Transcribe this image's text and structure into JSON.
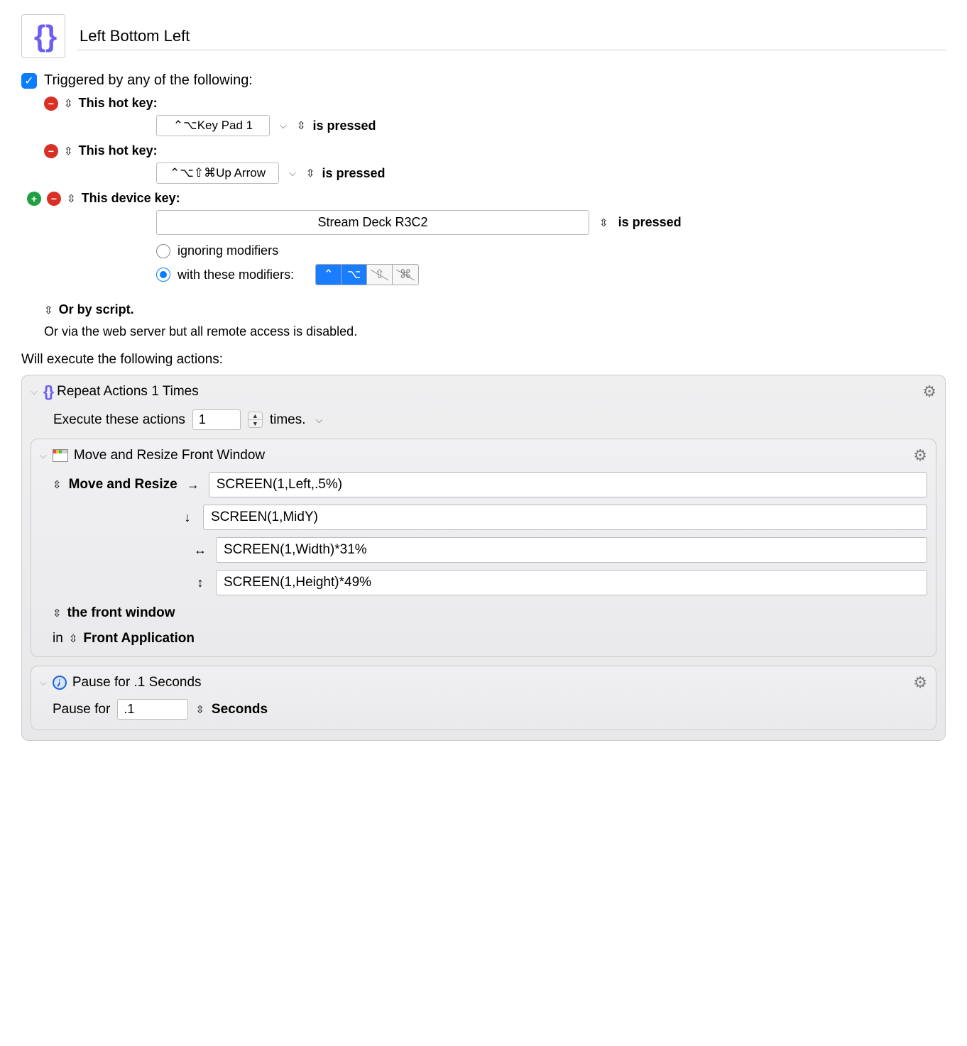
{
  "macro_title": "Left Bottom Left",
  "triggered_label": "Triggered by any of the following:",
  "hotkey_label": "This hot key:",
  "device_key_label": "This device key:",
  "is_pressed": "is pressed",
  "hotkey1": "⌃⌥Key Pad 1",
  "hotkey2": "⌃⌥⇧⌘Up Arrow",
  "device_key": "Stream Deck R3C2",
  "ignoring_mods": "ignoring modifiers",
  "with_mods": "with these modifiers:",
  "mods": {
    "ctrl": "⌃",
    "opt": "⌥",
    "shift": "⇧",
    "cmd": "⌘"
  },
  "or_script": "Or by script.",
  "remote_text": "Or via the web server but all remote access is disabled.",
  "will_execute": "Will execute the following actions:",
  "repeat_title": "Repeat Actions 1 Times",
  "execute_these": "Execute these actions",
  "times_label": "times.",
  "repeat_count": "1",
  "move_resize_title": "Move and Resize Front Window",
  "move_resize_label": "Move and Resize",
  "pos_right": "SCREEN(1,Left,.5%)",
  "pos_down": "SCREEN(1,MidY)",
  "pos_width": "SCREEN(1,Width)*31%",
  "pos_height": "SCREEN(1,Height)*49%",
  "front_window": "the front window",
  "in_label": "in",
  "front_app": "Front Application",
  "pause_title": "Pause for .1 Seconds",
  "pause_for": "Pause for",
  "pause_value": ".1",
  "seconds": "Seconds"
}
